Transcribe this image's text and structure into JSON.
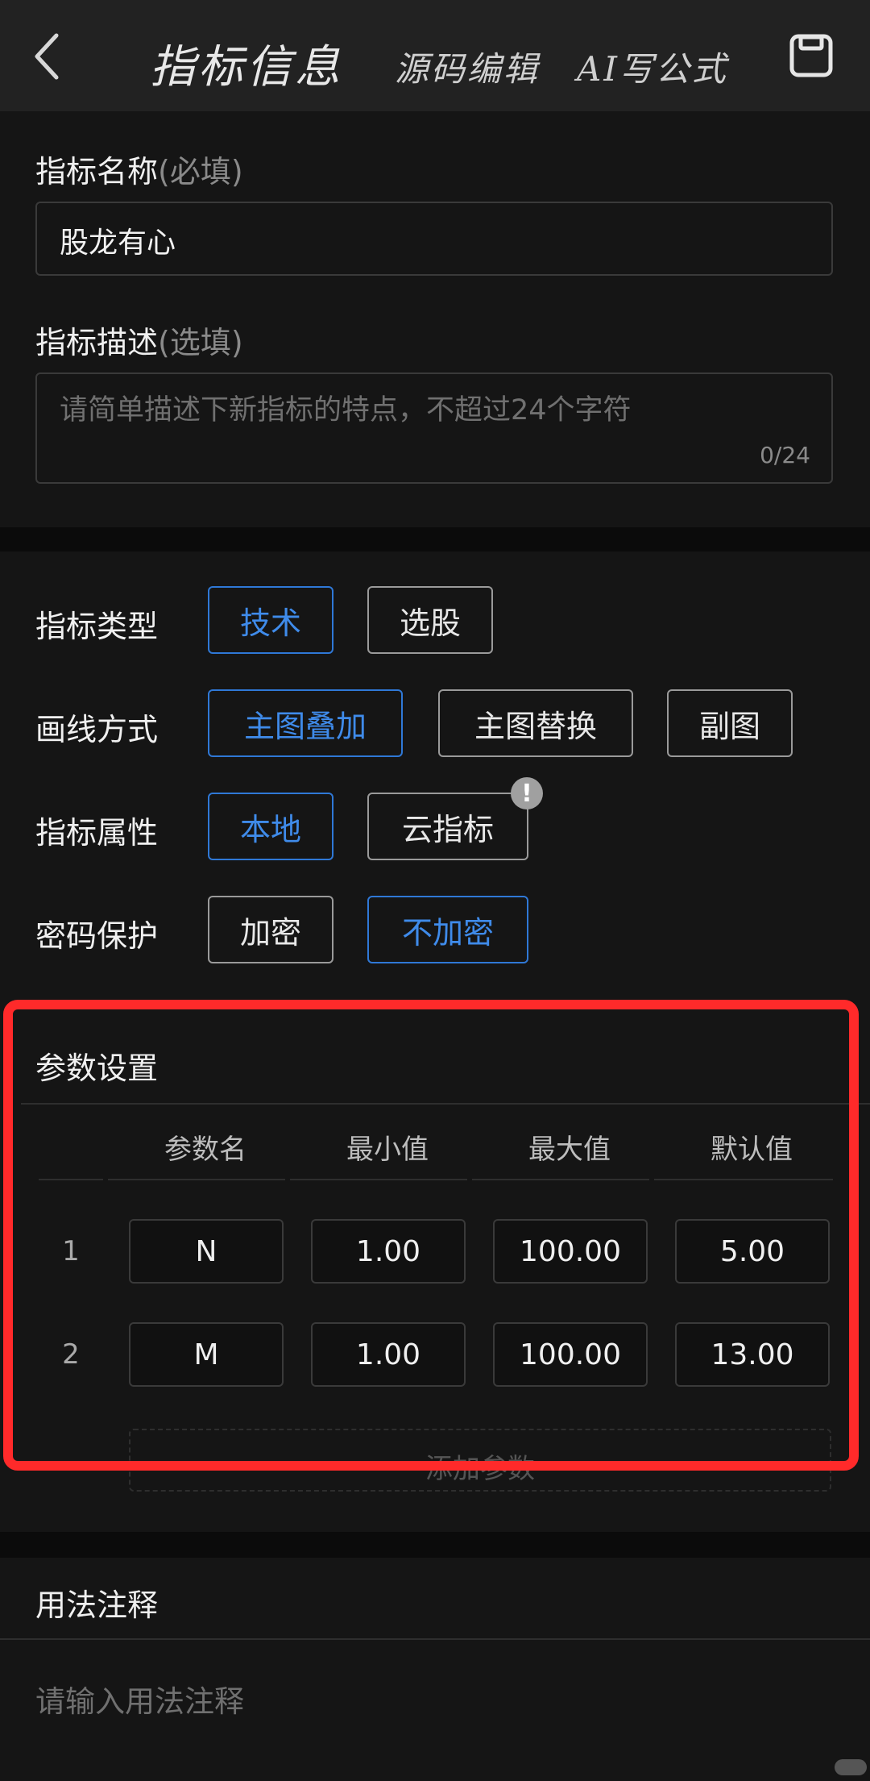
{
  "header": {
    "tabs": [
      {
        "label": "指标信息"
      },
      {
        "label": "源码编辑"
      },
      {
        "label": "AI写公式"
      }
    ]
  },
  "name_field": {
    "label": "指标名称",
    "hint": "(必填)",
    "value": "股龙有心"
  },
  "desc_field": {
    "label": "指标描述",
    "hint": "(选填)",
    "placeholder": "请简单描述下新指标的特点，不超过24个字符",
    "counter": "0/24"
  },
  "options": {
    "type": {
      "label": "指标类型",
      "choices": [
        "技术",
        "选股"
      ],
      "selected": "技术"
    },
    "draw": {
      "label": "画线方式",
      "choices": [
        "主图叠加",
        "主图替换",
        "副图"
      ],
      "selected": "主图叠加"
    },
    "attr": {
      "label": "指标属性",
      "choices": [
        "本地",
        "云指标"
      ],
      "selected": "本地",
      "badge": "!"
    },
    "password": {
      "label": "密码保护",
      "choices": [
        "加密",
        "不加密"
      ],
      "selected": "不加密"
    }
  },
  "params": {
    "title": "参数设置",
    "headers": [
      "参数名",
      "最小值",
      "最大值",
      "默认值"
    ],
    "rows": [
      {
        "index": "1",
        "name": "N",
        "min": "1.00",
        "max": "100.00",
        "default": "5.00"
      },
      {
        "index": "2",
        "name": "M",
        "min": "1.00",
        "max": "100.00",
        "default": "13.00"
      }
    ],
    "add_label": "添加参数"
  },
  "usage": {
    "title": "用法注释",
    "placeholder": "请输入用法注释"
  },
  "colors": {
    "accent": "#2f78d6",
    "highlight_frame": "#ff2a2a",
    "background": "#0b0b0b"
  }
}
